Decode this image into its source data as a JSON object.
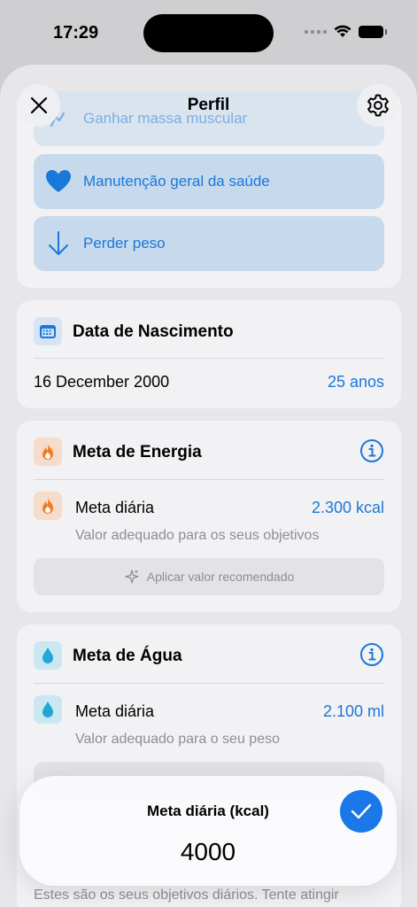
{
  "status": {
    "time": "17:29"
  },
  "nav": {
    "title": "Perfil"
  },
  "goals": {
    "options": [
      {
        "label": "Ganhar massa muscular",
        "icon": "arm-icon"
      },
      {
        "label": "Manutenção geral da saúde",
        "icon": "heart-icon"
      },
      {
        "label": "Perder peso",
        "icon": "arrow-down-icon"
      }
    ]
  },
  "birth": {
    "title": "Data de Nascimento",
    "date": "16 December 2000",
    "age": "25 anos"
  },
  "energy": {
    "title": "Meta de Energia",
    "daily_label": "Meta diária",
    "daily_value": "2.300 kcal",
    "hint": "Valor adequado para os seus objetivos",
    "recommend": "Aplicar valor recomendado"
  },
  "water": {
    "title": "Meta de Água",
    "daily_label": "Meta diária",
    "daily_value": "2.100 ml",
    "hint": "Valor adequado para o seu peso"
  },
  "editor": {
    "title": "Meta diária (kcal)",
    "value": "4000"
  },
  "footer": {
    "text": "Estes são os seus objetivos diários. Tente atingir"
  },
  "colors": {
    "accent": "#1a78d8",
    "energy": "#ef7d22",
    "water": "#22a6d6"
  }
}
